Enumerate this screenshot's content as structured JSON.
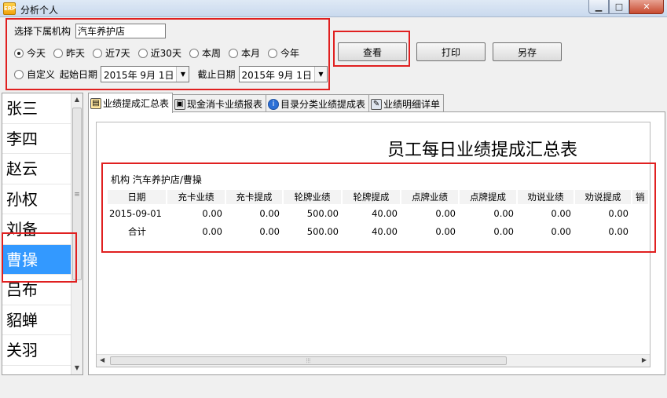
{
  "window": {
    "title": "分析个人",
    "icon_text": "ERP"
  },
  "filter": {
    "org_label": "选择下属机构",
    "org_value": "汽车养护店",
    "radios": [
      {
        "label": "今天",
        "checked": true
      },
      {
        "label": "昨天",
        "checked": false
      },
      {
        "label": "近7天",
        "checked": false
      },
      {
        "label": "近30天",
        "checked": false
      },
      {
        "label": "本周",
        "checked": false
      },
      {
        "label": "本月",
        "checked": false
      },
      {
        "label": "今年",
        "checked": false
      }
    ],
    "custom_label": "自定义",
    "start_label": "起始日期",
    "start_value": "2015年 9月 1日",
    "end_label": "截止日期",
    "end_value": "2015年 9月 1日"
  },
  "buttons": {
    "view": "查看",
    "print": "打印",
    "save_as": "另存"
  },
  "employees": [
    "张三",
    "李四",
    "赵云",
    "孙权",
    "刘备",
    "曹操",
    "吕布",
    "貂蝉",
    "关羽"
  ],
  "selected_employee": "曹操",
  "tabs": [
    {
      "label": "业绩提成汇总表",
      "icon": "report-icon",
      "active": true
    },
    {
      "label": "现金消卡业绩报表",
      "icon": "card-icon",
      "active": false
    },
    {
      "label": "目录分类业绩提成表",
      "icon": "info-icon",
      "active": false
    },
    {
      "label": "业绩明细详单",
      "icon": "detail-icon",
      "active": false
    }
  ],
  "report": {
    "title": "员工每日业绩提成汇总表",
    "org_line": "机构 汽车养护店/曹操",
    "columns": [
      "日期",
      "充卡业绩",
      "充卡提成",
      "轮牌业绩",
      "轮牌提成",
      "点牌业绩",
      "点牌提成",
      "劝说业绩",
      "劝说提成",
      "销"
    ],
    "rows": [
      [
        "2015-09-01",
        "0.00",
        "0.00",
        "500.00",
        "40.00",
        "0.00",
        "0.00",
        "0.00",
        "0.00",
        ""
      ],
      [
        "合计",
        "0.00",
        "0.00",
        "500.00",
        "40.00",
        "0.00",
        "0.00",
        "0.00",
        "0.00",
        ""
      ]
    ]
  }
}
